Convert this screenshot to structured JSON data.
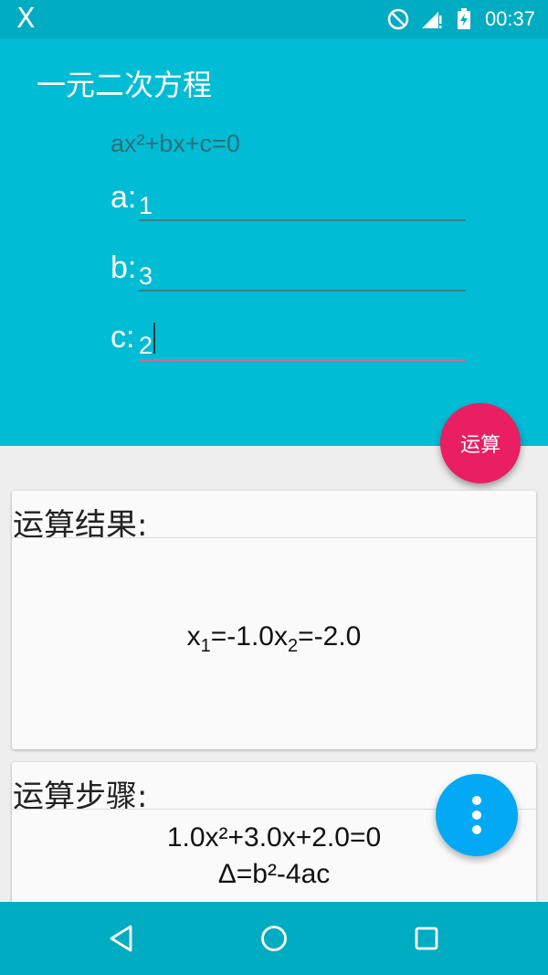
{
  "status_bar": {
    "app_glyph": "X",
    "time": "00:37",
    "icons": [
      "do-not-disturb-icon",
      "signal-icon",
      "battery-charging-icon"
    ]
  },
  "header": {
    "title": "一元二次方程",
    "formula": "ax²+bx+c=0",
    "fields": [
      {
        "label": "a:",
        "value": "1"
      },
      {
        "label": "b:",
        "value": "3"
      },
      {
        "label": "c:",
        "value": "2"
      }
    ],
    "calc_button": "运算"
  },
  "result_card": {
    "title": "运算结果:",
    "x1_name": "x",
    "x1_sub": "1",
    "x1_value": "=-1.0",
    "x2_name": "x",
    "x2_sub": "2",
    "x2_value": "=-2.0"
  },
  "steps_card": {
    "title": "运算步骤:",
    "lines": [
      "1.0x²+3.0x+2.0=0",
      "Δ=b²-4ac"
    ]
  },
  "colors": {
    "header": "#00bcd4",
    "status_bar": "#00acc1",
    "accent": "#e91e63",
    "fab": "#03a9f4"
  }
}
